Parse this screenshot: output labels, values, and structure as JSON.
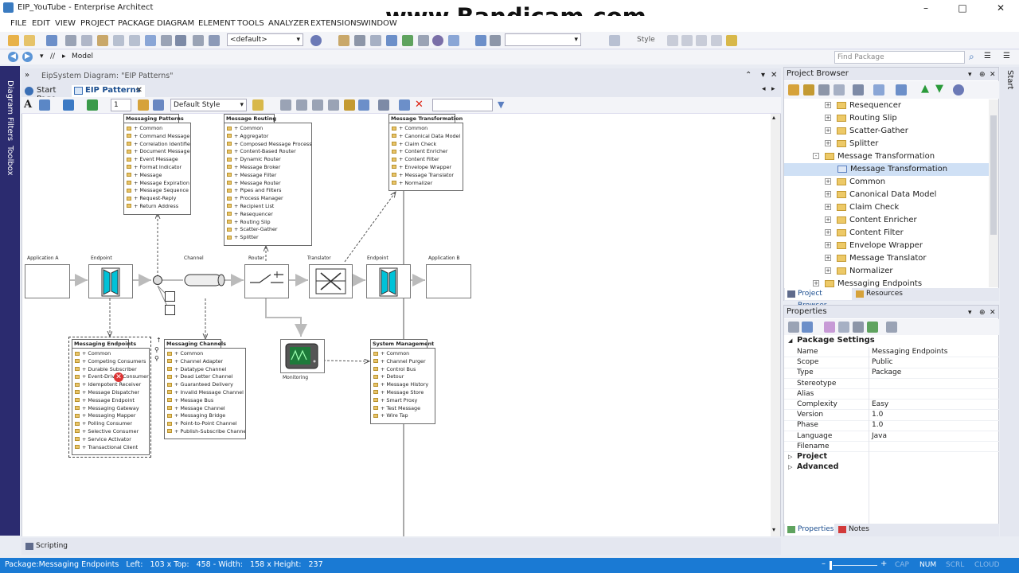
{
  "window": {
    "title": "EIP_YouTube - Enterprise Architect"
  },
  "watermark": "www.Bandicam.com",
  "menu": [
    "FILE",
    "EDIT",
    "VIEW",
    "PROJECT",
    "PACKAGE",
    "DIAGRAM",
    "ELEMENT",
    "TOOLS",
    "ANALYZER",
    "EXTENSIONS",
    "WINDOW"
  ],
  "toolbar": {
    "default_combo": "<default>",
    "style_label": "Style"
  },
  "nav": {
    "path_sep": "//",
    "path": "Model",
    "find_placeholder": "Find Package"
  },
  "side_tabs": {
    "filters": "Diagram Filters",
    "toolbox": "Toolbox",
    "start": "Start"
  },
  "diagram_header": {
    "title": "EipSystem Diagram: \"EIP Patterns\""
  },
  "tabs": [
    {
      "label": "Start Page"
    },
    {
      "label": "EIP Patterns"
    }
  ],
  "diagram_toolbar": {
    "zoom": "1",
    "style": "Default Style"
  },
  "diagram": {
    "labels": {
      "app_a": "Application A",
      "endpoint1": "Endpoint",
      "channel": "Channel",
      "router": "Router",
      "translator": "Translator",
      "endpoint2": "Endpoint",
      "app_b": "Application B",
      "monitoring": "Monitoring"
    },
    "packages": {
      "patterns": {
        "name": "Messaging Patterns",
        "items": [
          "+ Common",
          "+ Command Message",
          "+ Correlation Identifier",
          "+ Document Message",
          "+ Event Message",
          "+ Format Indicator",
          "+ Message",
          "+ Message Expiration",
          "+ Message Sequence",
          "+ Request-Reply",
          "+ Return Address"
        ]
      },
      "routing": {
        "name": "Message Routing",
        "items": [
          "+ Common",
          "+ Aggregator",
          "+ Composed Message Processor",
          "+ Content-Based Router",
          "+ Dynamic Router",
          "+ Message Broker",
          "+ Message Filter",
          "+ Message Router",
          "+ Pipes and Filters",
          "+ Process Manager",
          "+ Recipient List",
          "+ Resequencer",
          "+ Routing Slip",
          "+ Scatter-Gather",
          "+ Splitter"
        ]
      },
      "transformation": {
        "name": "Message Transformation",
        "items": [
          "+ Common",
          "+ Canonical Data Model",
          "+ Claim Check",
          "+ Content Enricher",
          "+ Content Filter",
          "+ Envelope Wrapper",
          "+ Message Translator",
          "+ Normalizer"
        ]
      },
      "endpoints": {
        "name": "Messaging Endpoints",
        "items": [
          "+ Common",
          "+ Competing Consumers",
          "+ Durable Subscriber",
          "+ Event-Driven Consumer",
          "+ Idempotent Receiver",
          "+ Message Dispatcher",
          "+ Message Endpoint",
          "+ Messaging Gateway",
          "+ Messaging Mapper",
          "+ Polling Consumer",
          "+ Selective Consumer",
          "+ Service Activator",
          "+ Transactional Client"
        ]
      },
      "channels": {
        "name": "Messaging Channels",
        "items": [
          "+ Common",
          "+ Channel Adapter",
          "+ Datatype Channel",
          "+ Dead Letter Channel",
          "+ Guaranteed Delivery",
          "+ Invalid Message Channel",
          "+ Message Bus",
          "+ Message Channel",
          "+ Messaging Bridge",
          "+ Point-to-Point Channel",
          "+ Publish-Subscribe Channel"
        ]
      },
      "system": {
        "name": "System Management",
        "items": [
          "+ Common",
          "+ Channel Purger",
          "+ Control Bus",
          "+ Detour",
          "+ Message History",
          "+ Message Store",
          "+ Smart Proxy",
          "+ Test Message",
          "+ Wire Tap"
        ]
      }
    }
  },
  "project_browser": {
    "title": "Project Browser",
    "items": [
      {
        "label": "Resequencer",
        "indent": 2,
        "type": "folder",
        "exp": "+"
      },
      {
        "label": "Routing Slip",
        "indent": 2,
        "type": "folder",
        "exp": "+"
      },
      {
        "label": "Scatter-Gather",
        "indent": 2,
        "type": "folder",
        "exp": "+"
      },
      {
        "label": "Splitter",
        "indent": 2,
        "type": "folder",
        "exp": "+"
      },
      {
        "label": "Message Transformation",
        "indent": 1,
        "type": "folder",
        "exp": "-"
      },
      {
        "label": "Message Transformation",
        "indent": 2,
        "type": "diagram",
        "exp": ""
      },
      {
        "label": "Common",
        "indent": 2,
        "type": "folder",
        "exp": "+"
      },
      {
        "label": "Canonical Data Model",
        "indent": 2,
        "type": "folder",
        "exp": "+"
      },
      {
        "label": "Claim Check",
        "indent": 2,
        "type": "folder",
        "exp": "+"
      },
      {
        "label": "Content Enricher",
        "indent": 2,
        "type": "folder",
        "exp": "+"
      },
      {
        "label": "Content Filter",
        "indent": 2,
        "type": "folder",
        "exp": "+"
      },
      {
        "label": "Envelope Wrapper",
        "indent": 2,
        "type": "folder",
        "exp": "+"
      },
      {
        "label": "Message Translator",
        "indent": 2,
        "type": "folder",
        "exp": "+"
      },
      {
        "label": "Normalizer",
        "indent": 2,
        "type": "folder",
        "exp": "+"
      },
      {
        "label": "Messaging Endpoints",
        "indent": 1,
        "type": "folder",
        "exp": "+"
      }
    ],
    "bottom_tabs": [
      "Project Browser",
      "Resources"
    ]
  },
  "properties": {
    "title": "Properties",
    "section": "Package Settings",
    "rows": [
      {
        "k": "Name",
        "v": "Messaging Endpoints"
      },
      {
        "k": "Scope",
        "v": "Public"
      },
      {
        "k": "Type",
        "v": "Package"
      },
      {
        "k": "Stereotype",
        "v": ""
      },
      {
        "k": "Alias",
        "v": ""
      },
      {
        "k": "Complexity",
        "v": "Easy"
      },
      {
        "k": "Version",
        "v": "1.0"
      },
      {
        "k": "Phase",
        "v": "1.0"
      },
      {
        "k": "Language",
        "v": "Java"
      },
      {
        "k": "Filename",
        "v": ""
      }
    ],
    "groups": [
      "Project",
      "Advanced"
    ],
    "bottom_tabs": [
      "Properties",
      "Notes"
    ]
  },
  "scripting": "Scripting",
  "status": {
    "text": "Package:Messaging Endpoints   Left:   103 x Top:   458 - Width:   158 x Height:   237",
    "indicators": [
      "CAP",
      "NUM",
      "SCRL",
      "CLOUD"
    ]
  },
  "colors": {
    "accent": "#1a7ad4",
    "selection": "#cfe0f5",
    "folder": "#edc967",
    "device": "#00c2d8",
    "monitor_screen": "#1e7a3a"
  }
}
